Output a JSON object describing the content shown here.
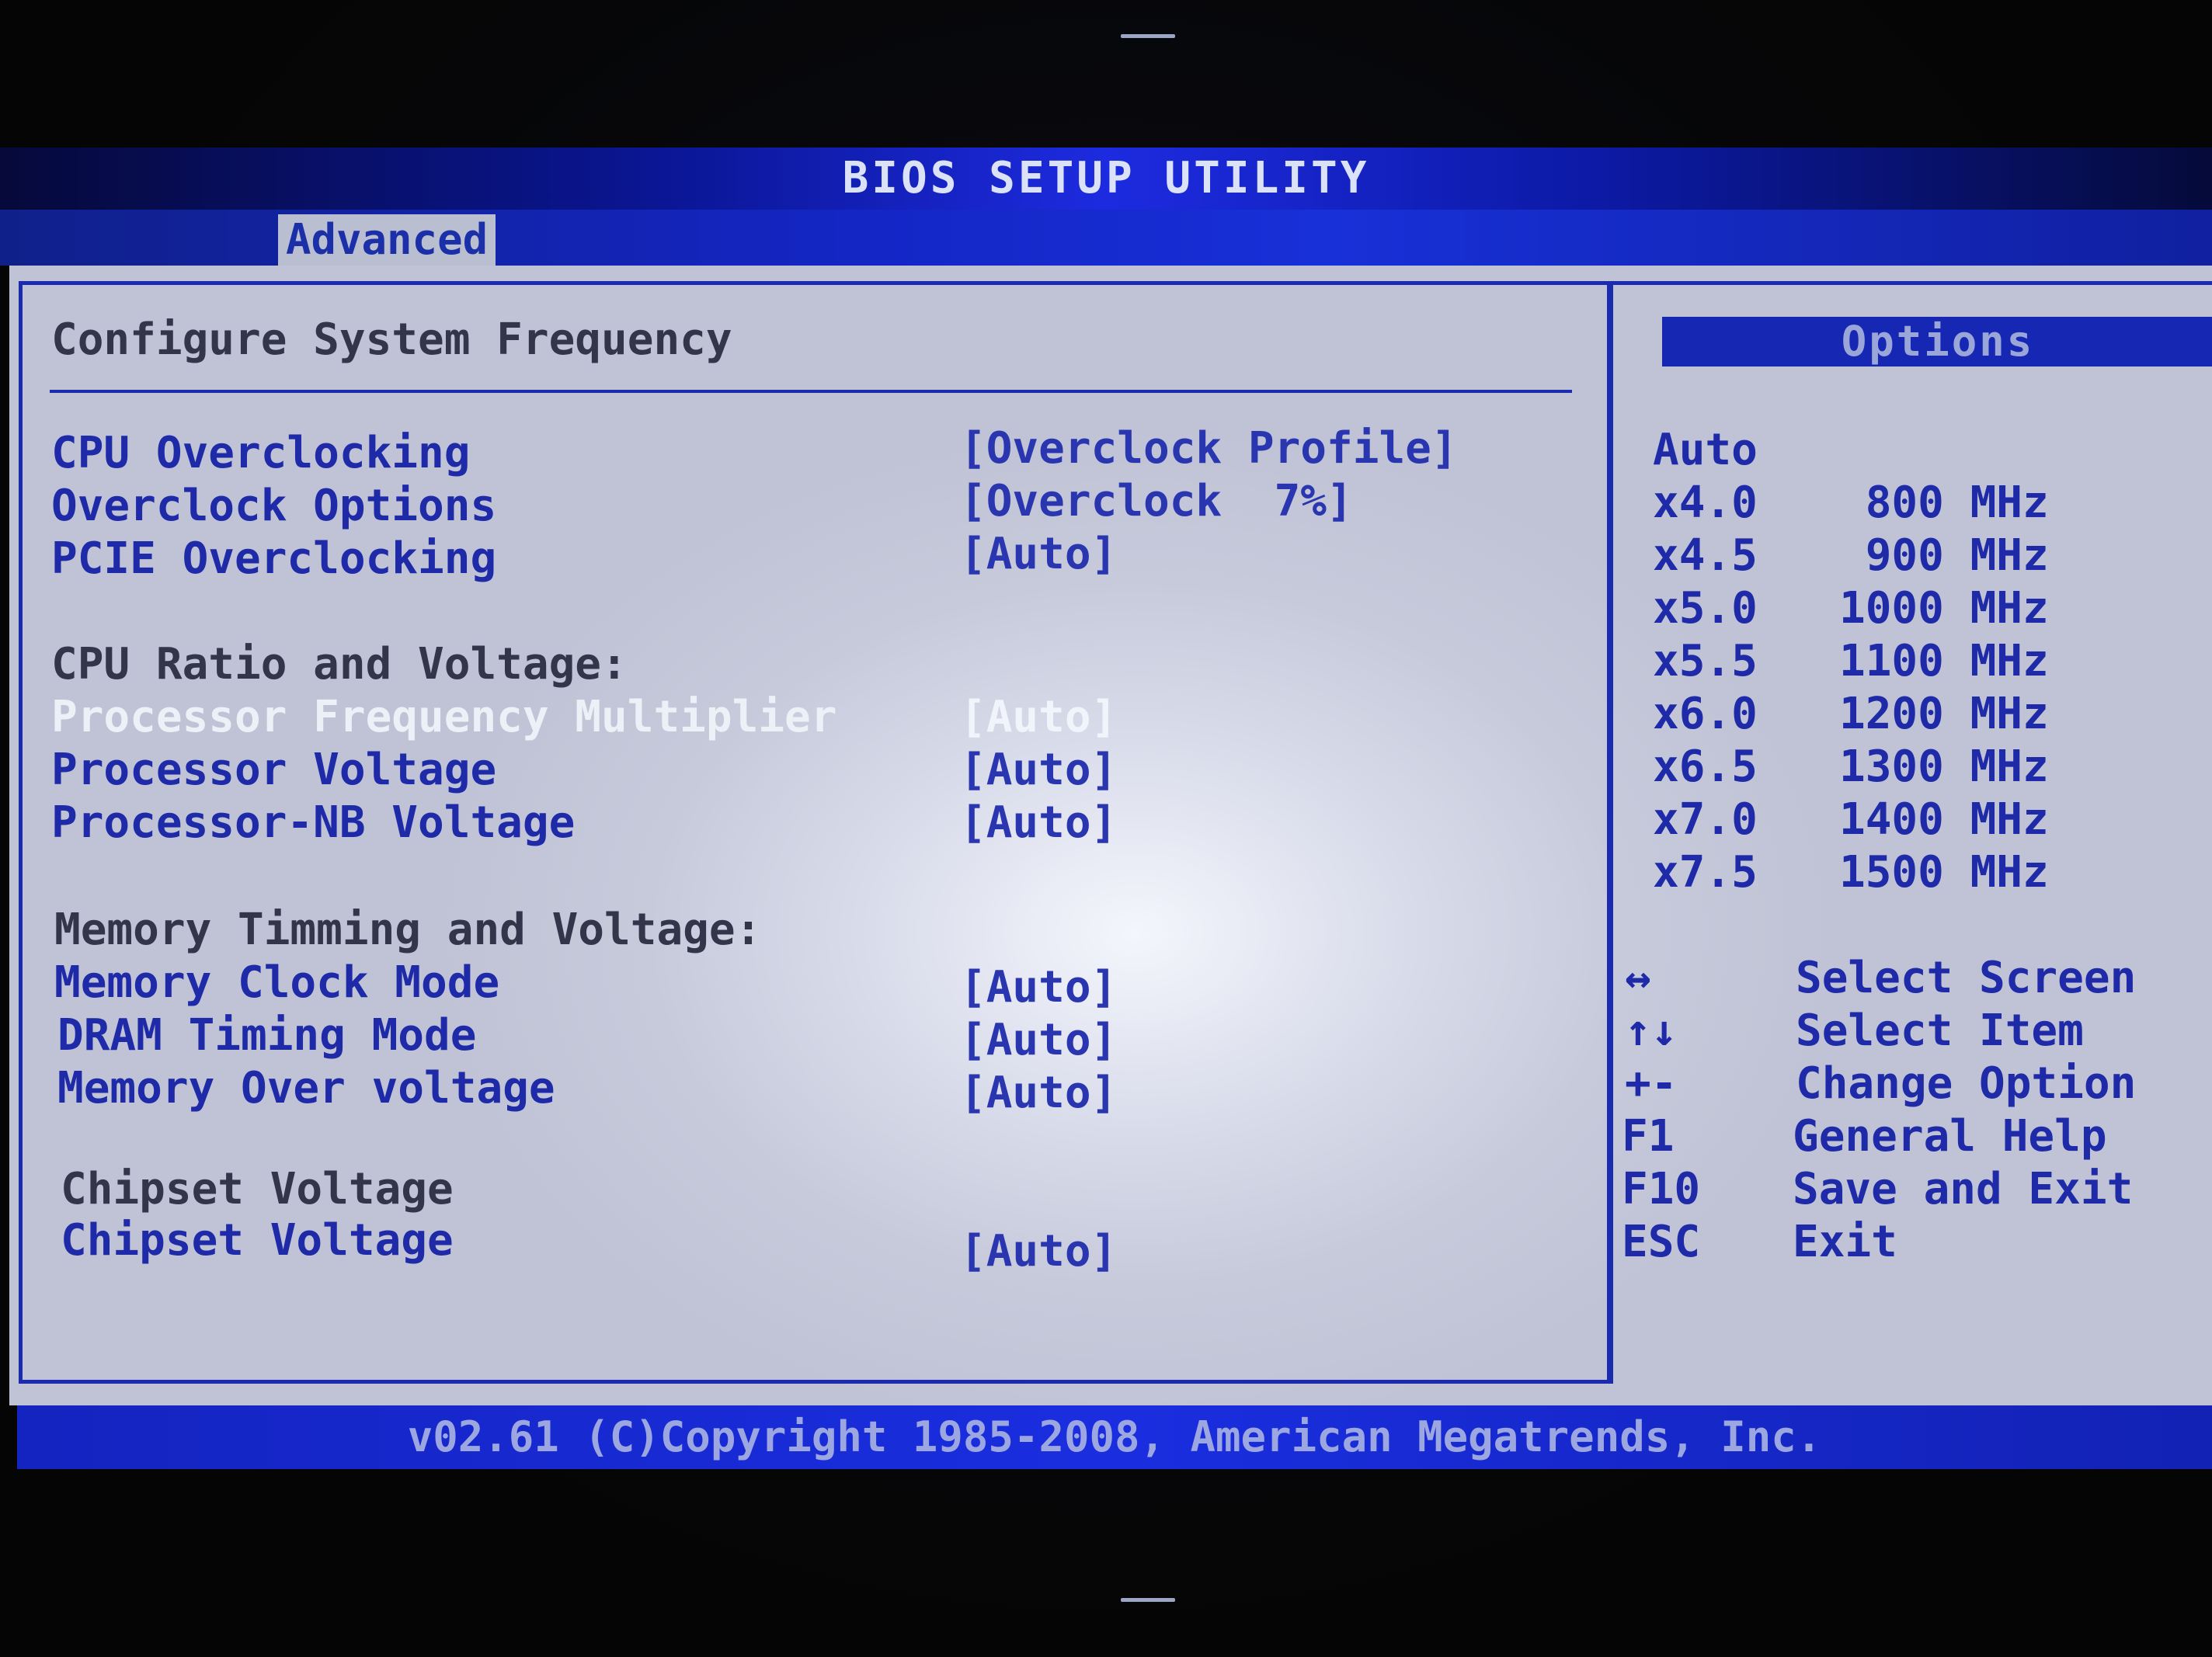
{
  "window": {
    "title": "BIOS SETUP UTILITY"
  },
  "menu": {
    "active_tab": "Advanced"
  },
  "main": {
    "section_title": "Configure System Frequency",
    "rows": [
      {
        "label": "CPU Overclocking",
        "value": "[Overclock Profile]",
        "kind": "item"
      },
      {
        "label": "Overclock Options",
        "value": "[Overclock  7%]",
        "kind": "item"
      },
      {
        "label": "PCIE Overclocking",
        "value": "[Auto]",
        "kind": "item"
      },
      {
        "label": "CPU Ratio and Voltage:",
        "value": "",
        "kind": "heading"
      },
      {
        "label": "Processor Frequency Multiplier",
        "value": "[Auto]",
        "kind": "selected"
      },
      {
        "label": "Processor Voltage",
        "value": "[Auto]",
        "kind": "item"
      },
      {
        "label": "Processor-NB Voltage",
        "value": "[Auto]",
        "kind": "item"
      },
      {
        "label": "Memory Timming and Voltage:",
        "value": "",
        "kind": "heading"
      },
      {
        "label": "Memory Clock Mode",
        "value": "[Auto]",
        "kind": "item"
      },
      {
        "label": "DRAM Timing Mode",
        "value": "[Auto]",
        "kind": "item"
      },
      {
        "label": "Memory Over voltage",
        "value": "[Auto]",
        "kind": "item"
      },
      {
        "label": "Chipset Voltage",
        "value": "",
        "kind": "heading"
      },
      {
        "label": "Chipset Voltage",
        "value": "[Auto]",
        "kind": "item"
      }
    ]
  },
  "options": {
    "header": "Options",
    "items": [
      {
        "ratio": "Auto",
        "freq": ""
      },
      {
        "ratio": "x4.0",
        "freq": " 800 MHz"
      },
      {
        "ratio": "x4.5",
        "freq": " 900 MHz"
      },
      {
        "ratio": "x5.0",
        "freq": "1000 MHz"
      },
      {
        "ratio": "x5.5",
        "freq": "1100 MHz"
      },
      {
        "ratio": "x6.0",
        "freq": "1200 MHz"
      },
      {
        "ratio": "x6.5",
        "freq": "1300 MHz"
      },
      {
        "ratio": "x7.0",
        "freq": "1400 MHz"
      },
      {
        "ratio": "x7.5",
        "freq": "1500 MHz"
      }
    ]
  },
  "keyhelp": [
    {
      "key": "↔",
      "action": "Select Screen"
    },
    {
      "key": "↑↓",
      "action": "Select Item"
    },
    {
      "key": "+-",
      "action": "Change Option"
    },
    {
      "key": "F1",
      "action": "General Help"
    },
    {
      "key": "F10",
      "action": "Save and Exit"
    },
    {
      "key": "ESC",
      "action": "Exit"
    }
  ],
  "footer": {
    "text": "v02.61 (C)Copyright 1985-2008, American Megatrends, Inc."
  }
}
